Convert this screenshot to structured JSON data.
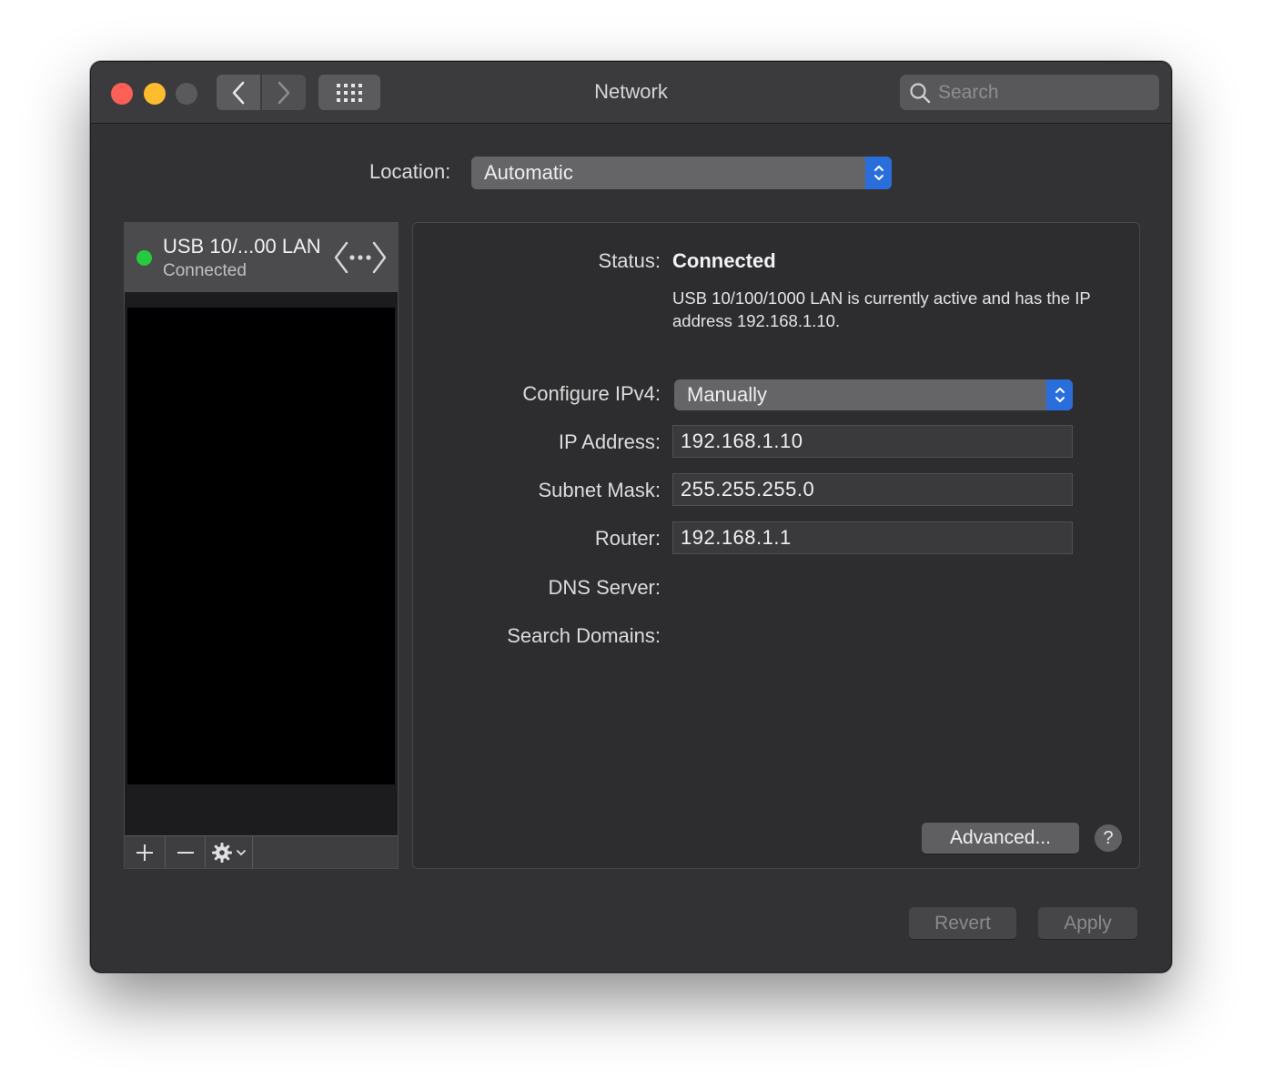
{
  "window": {
    "title": "Network"
  },
  "toolbar": {
    "search_placeholder": "Search"
  },
  "location": {
    "label": "Location:",
    "value": "Automatic"
  },
  "sidebar": {
    "items": [
      {
        "name": "USB 10/...00 LAN",
        "status": "Connected",
        "status_color": "#27c93f"
      }
    ]
  },
  "panel": {
    "status_label": "Status:",
    "status_value": "Connected",
    "status_description": "USB 10/100/1000 LAN is currently active and has the IP address 192.168.1.10.",
    "configure_label": "Configure IPv4:",
    "configure_value": "Manually",
    "ip_label": "IP Address:",
    "ip_value": "192.168.1.10",
    "subnet_label": "Subnet Mask:",
    "subnet_value": "255.255.255.0",
    "router_label": "Router:",
    "router_value": "192.168.1.1",
    "dns_label": "DNS Server:",
    "search_domains_label": "Search Domains:",
    "advanced_label": "Advanced...",
    "help_label": "?"
  },
  "footer": {
    "revert_label": "Revert",
    "apply_label": "Apply"
  },
  "colors": {
    "accent": "#2a6edc",
    "close": "#fe5f57",
    "minimize": "#febc2e",
    "zoom": "#5a5a5c"
  }
}
